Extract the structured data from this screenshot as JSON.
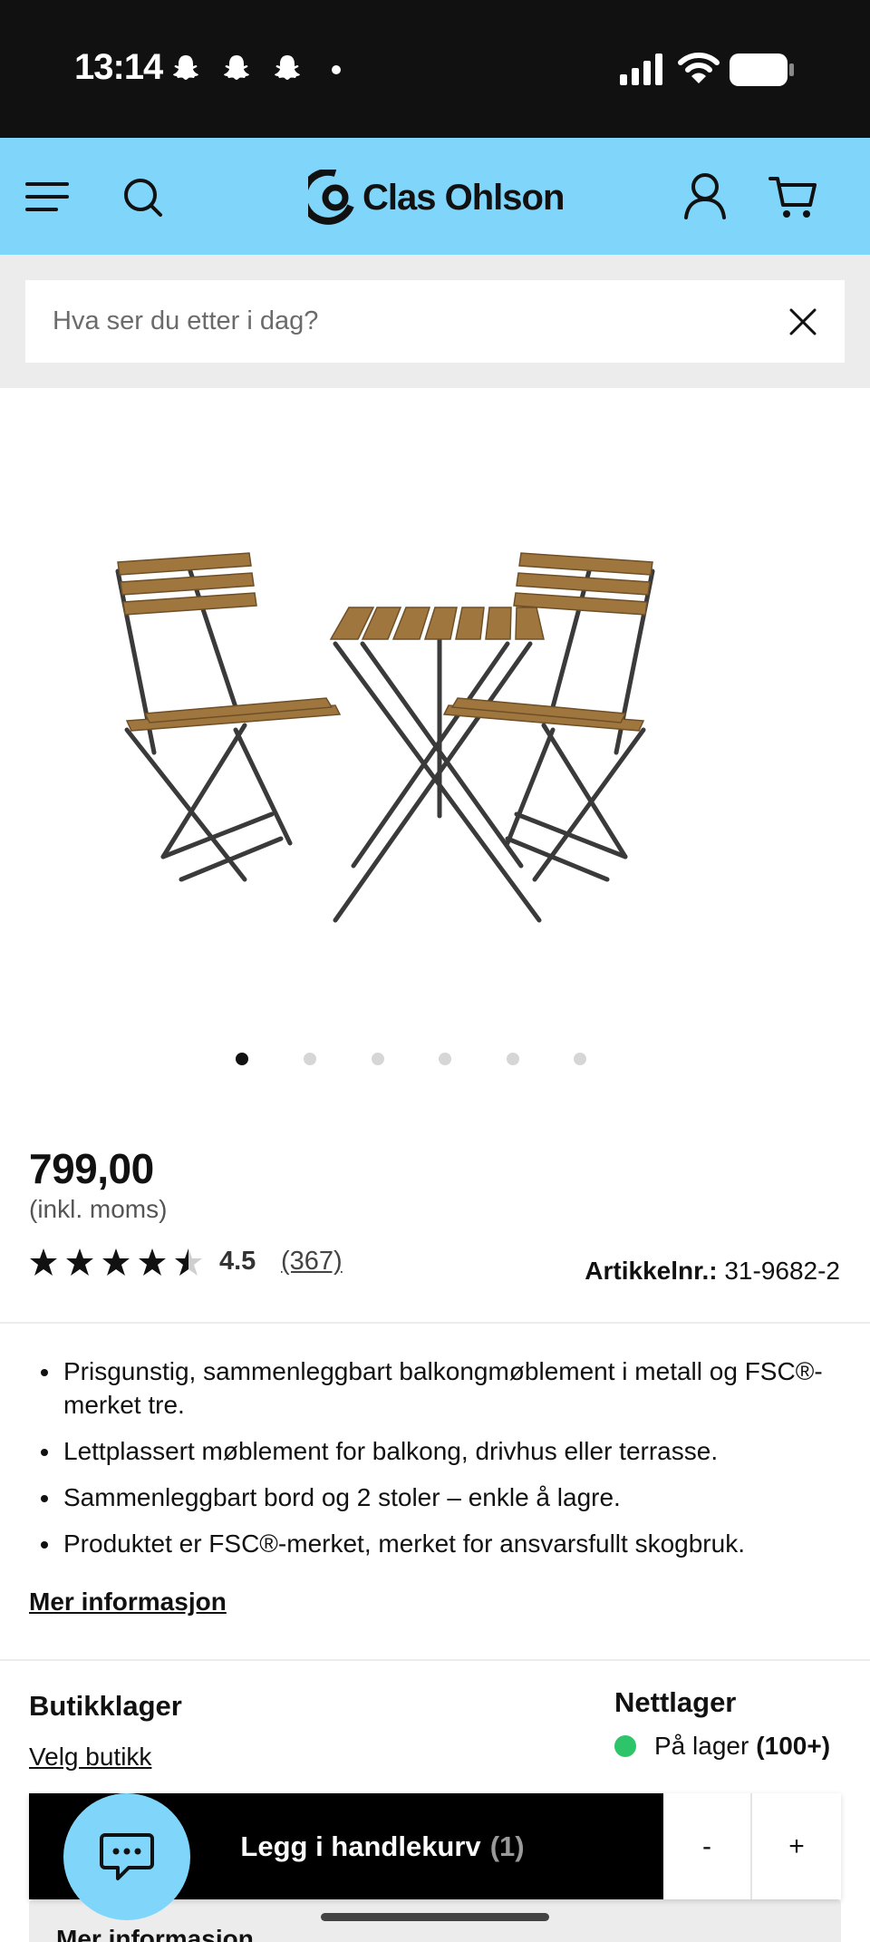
{
  "status_bar": {
    "time": "13:14"
  },
  "header": {
    "brand": "Clas Ohlson",
    "brand_color": "#7fd6fa"
  },
  "search": {
    "placeholder": "Hva ser du etter i dag?",
    "value": ""
  },
  "gallery": {
    "image_count": 6,
    "active_index": 0
  },
  "product": {
    "price": "799,00",
    "price_note": "(inkl. moms)",
    "rating_value": "4.5",
    "rating_stars": 4.5,
    "rating_count": "(367)",
    "article_label": "Artikkelnr.:",
    "article_number": "31-9682-2",
    "bullets": [
      "Prisgunstig, sammenleggbart balkongmøblement i metall og FSC®-merket tre.",
      "Lettplassert møblement for balkong, drivhus eller terrasse.",
      "Sammenleggbart bord og 2 stoler – enkle å lagre.",
      "Produktet er FSC®-merket, merket for ansvarsfullt skogbruk."
    ],
    "more_info_link": "Mer informasjon"
  },
  "stock": {
    "store_title": "Butikklager",
    "store_link": "Velg butikk",
    "online_title": "Nettlager",
    "online_status": "På lager",
    "online_quantity": "(100+)",
    "status_color": "#2ec46a"
  },
  "cart_bar": {
    "add_label": "Legg i handlekurv",
    "count": "(1)",
    "minus": "-",
    "plus": "+"
  },
  "accordion": {
    "label": "Mer informasjon"
  }
}
